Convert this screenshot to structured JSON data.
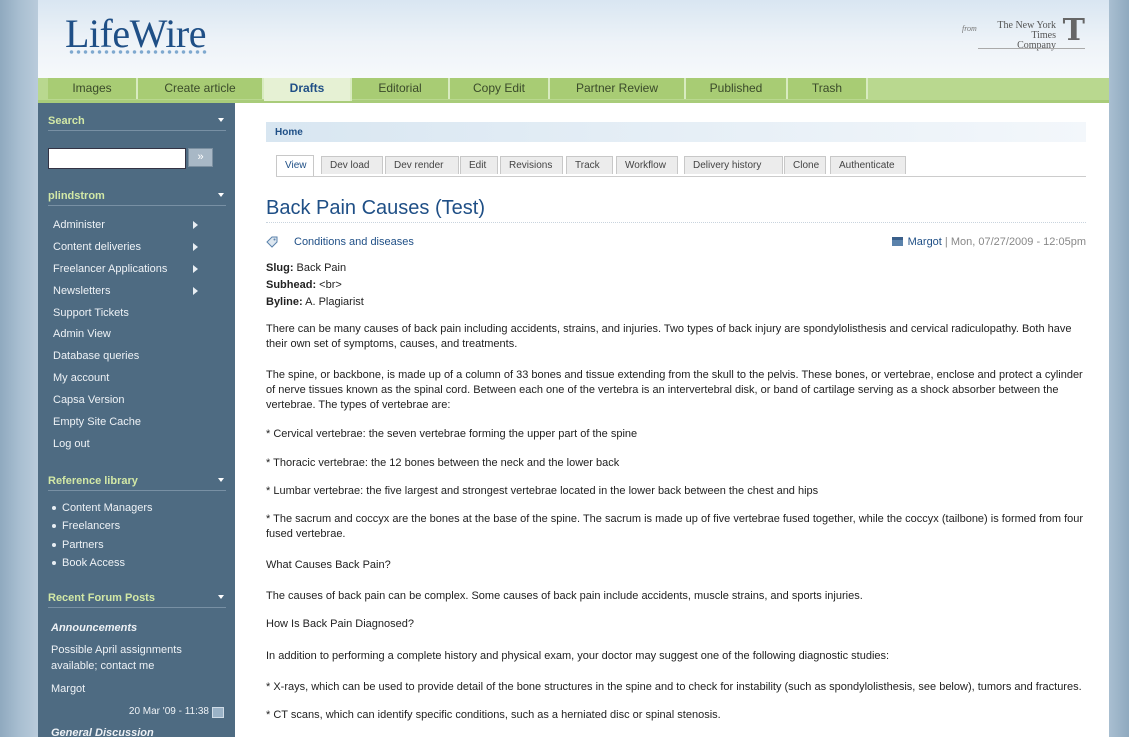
{
  "header": {
    "logo": "LifeWire",
    "nyt_from": "from",
    "nyt_line1": "The New York Times",
    "nyt_line2": "Company",
    "nyt_mark": "T"
  },
  "tabs": [
    {
      "label": "Images",
      "active": false
    },
    {
      "label": "Create article",
      "active": false
    },
    {
      "label": "Drafts",
      "active": true
    },
    {
      "label": "Editorial",
      "active": false
    },
    {
      "label": "Copy Edit",
      "active": false
    },
    {
      "label": "Partner Review",
      "active": false
    },
    {
      "label": "Published",
      "active": false
    },
    {
      "label": "Trash",
      "active": false
    }
  ],
  "sidebar": {
    "search": {
      "title": "Search",
      "value": "",
      "button": "»"
    },
    "user": {
      "title": "plindstrom",
      "items": [
        {
          "label": "Administer",
          "submenu": true
        },
        {
          "label": "Content deliveries",
          "submenu": true
        },
        {
          "label": "Freelancer Applications",
          "submenu": true
        },
        {
          "label": "Newsletters",
          "submenu": true
        },
        {
          "label": "Support Tickets",
          "submenu": false
        },
        {
          "label": "Admin View",
          "submenu": false
        },
        {
          "label": "Database queries",
          "submenu": false
        },
        {
          "label": "My account",
          "submenu": false
        },
        {
          "label": "Capsa Version",
          "submenu": false
        },
        {
          "label": "Empty Site Cache",
          "submenu": false
        },
        {
          "label": "Log out",
          "submenu": false
        }
      ]
    },
    "reference": {
      "title": "Reference library",
      "items": [
        "Content Managers",
        "Freelancers",
        "Partners",
        "Book Access"
      ]
    },
    "forum": {
      "title": "Recent Forum Posts",
      "section1": "Announcements",
      "post_text": "Possible April assignments available; contact me",
      "post_author": "Margot",
      "post_date": "20 Mar '09 - 11:38",
      "section2": "General Discussion"
    }
  },
  "content": {
    "breadcrumb": "Home",
    "subtabs": [
      {
        "label": "View",
        "active": true
      },
      {
        "label": "Dev load",
        "active": false
      },
      {
        "label": "Dev render",
        "active": false
      },
      {
        "label": "Edit",
        "active": false
      },
      {
        "label": "Revisions",
        "active": false
      },
      {
        "label": "Track",
        "active": false
      },
      {
        "label": "Workflow",
        "active": false
      },
      {
        "label": "Delivery history",
        "active": false
      },
      {
        "label": "Clone",
        "active": false
      },
      {
        "label": "Authenticate",
        "active": false
      }
    ],
    "title": "Back Pain Causes (Test)",
    "tag": "Conditions and diseases",
    "author": "Margot",
    "date": " | Mon, 07/27/2009 - 12:05pm",
    "slug_label": "Slug:",
    "slug": " Back Pain",
    "subhead_label": "Subhead:",
    "subhead": " <br>",
    "byline_label": "Byline:",
    "byline": " A. Plagiarist",
    "paragraphs": [
      "There can be many causes of back pain including accidents, strains, and injuries. Two types of back injury are spondylolisthesis and cervical radiculopathy. Both have their own set of symptoms, causes, and treatments.",
      "The spine, or backbone, is made up of a column of 33 bones and tissue extending from the skull to the pelvis. These bones, or vertebrae, enclose and protect a cylinder of nerve tissues known as the spinal cord. Between each one of the vertebra is an intervertebral disk, or band of cartilage serving as a shock absorber between the vertebrae. The types of vertebrae are:",
      "* Cervical vertebrae: the seven vertebrae forming the upper part of the spine",
      "* Thoracic vertebrae: the 12 bones between the neck and the lower back",
      "* Lumbar vertebrae: the five largest and strongest vertebrae located in the lower back between the chest and hips",
      "* The sacrum and coccyx are the bones at the base of the spine. The sacrum is made up of five vertebrae fused together, while the coccyx (tailbone) is formed from four fused vertebrae.",
      "What Causes Back Pain?",
      "The causes of back pain can be complex. Some causes of back pain include accidents, muscle strains, and sports injuries.",
      "How Is Back Pain Diagnosed?",
      "In addition to performing a complete history and physical exam, your doctor may suggest one of the following diagnostic studies:",
      "* X-rays, which can be used to provide detail of the bone structures in the spine and to check for instability (such as spondylolisthesis, see below), tumors and fractures.",
      "* CT scans, which can identify specific conditions, such as a herniated disc or spinal stenosis."
    ]
  }
}
